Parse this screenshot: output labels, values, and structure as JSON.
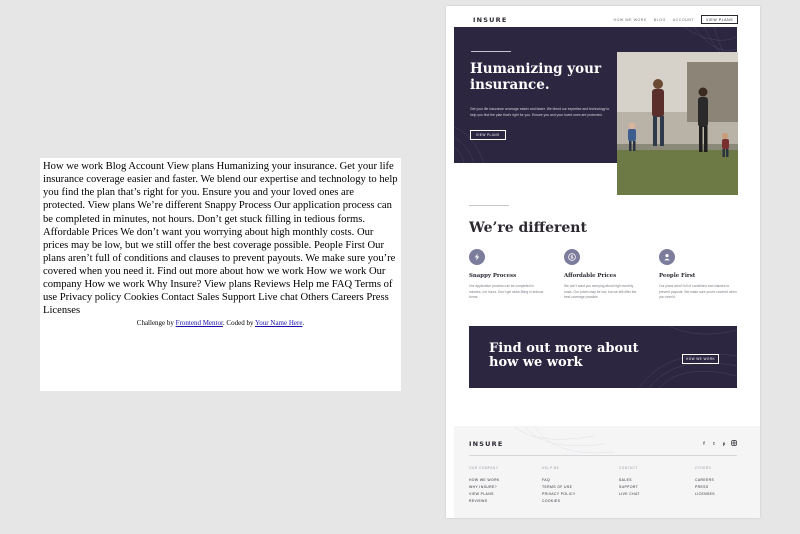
{
  "raw": {
    "text": "How we work Blog Account View plans Humanizing your insurance. Get your life insurance coverage easier and faster. We blend our expertise and technology to help you find the plan that’s right for you. Ensure you and your loved ones are protected. View plans We’re different Snappy Process Our application process can be completed in minutes, not hours. Don’t get stuck filling in tedious forms. Affordable Prices We don’t want you worrying about high monthly costs. Our prices may be low, but we still offer the best coverage possible. People First Our plans aren’t full of conditions and clauses to prevent payouts. We make sure you’re covered when you need it. Find out more about how we work How we work Our company How we work Why Insure? View plans Reviews Help me FAQ Terms of use Privacy policy Cookies Contact Sales Support Live chat Others Careers Press Licenses",
    "challenge_prefix": "Challenge by ",
    "challenge_link": "Frontend Mentor",
    "coded_prefix": ". Coded by ",
    "coded_link": "Your Name Here",
    "coded_suffix": "."
  },
  "site": {
    "logo": "INSURE",
    "nav": {
      "how_we_work": "How we work",
      "blog": "Blog",
      "account": "Account",
      "view_plans": "View plans"
    },
    "hero": {
      "title": "Humanizing your insurance.",
      "text": "Get your life insurance coverage easier and faster. We blend our expertise and technology to help you find the plan that’s right for you. Ensure you and your loved ones are protected.",
      "button": "View plans"
    },
    "different": {
      "title": "We’re different",
      "features": [
        {
          "icon": "lightning-icon",
          "title": "Snappy Process",
          "text": "Our application process can be completed in minutes, not hours. Don’t get stuck filling in tedious forms."
        },
        {
          "icon": "dollar-icon",
          "title": "Affordable Prices",
          "text": "We don’t want you worrying about high monthly costs. Our prices may be low, but we still offer the best coverage possible."
        },
        {
          "icon": "person-icon",
          "title": "People First",
          "text": "Our plans aren’t full of conditions and clauses to prevent payouts. We make sure you’re covered when you need it."
        }
      ]
    },
    "cta": {
      "title": "Find out more about how we work",
      "button": "How we work"
    },
    "footer": {
      "logo": "INSURE",
      "social": [
        "facebook-icon",
        "twitter-icon",
        "pinterest-icon",
        "instagram-icon"
      ],
      "columns": [
        {
          "heading": "Our company",
          "links": [
            "How we work",
            "Why Insure?",
            "View plans",
            "Reviews"
          ]
        },
        {
          "heading": "Help me",
          "links": [
            "FAQ",
            "Terms of use",
            "Privacy policy",
            "Cookies"
          ]
        },
        {
          "heading": "Contact",
          "links": [
            "Sales",
            "Support",
            "Live chat"
          ]
        },
        {
          "heading": "Others",
          "links": [
            "Careers",
            "Press",
            "Licenses"
          ]
        }
      ]
    },
    "colors": {
      "dark_violet": "#2c2640",
      "grayish_violet": "#7c7c9c",
      "light_bg": "#f5f5f6"
    }
  }
}
